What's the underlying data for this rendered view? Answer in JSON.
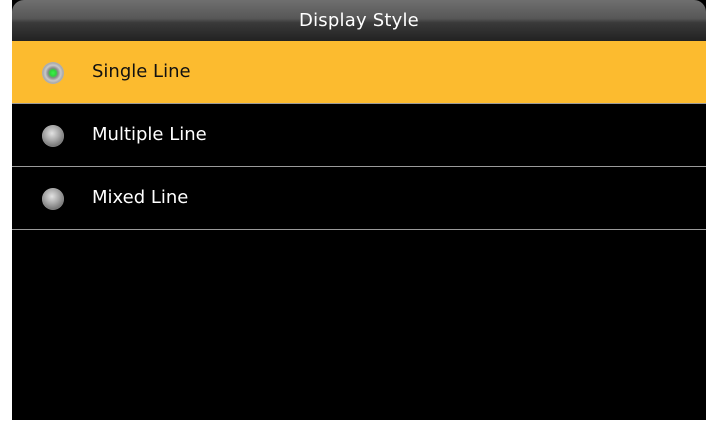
{
  "header": {
    "title": "Display Style"
  },
  "options": [
    {
      "label": "Single Line",
      "selected": true
    },
    {
      "label": "Multiple Line",
      "selected": false
    },
    {
      "label": "Mixed Line",
      "selected": false
    }
  ],
  "colors": {
    "highlight": "#fcbb2f",
    "background": "#000000",
    "radio_checked": "#2ed43a",
    "divider": "#9a9a9a"
  },
  "icons": {
    "radio_checked": "radio-checked-icon",
    "radio_unchecked": "radio-unchecked-icon"
  }
}
